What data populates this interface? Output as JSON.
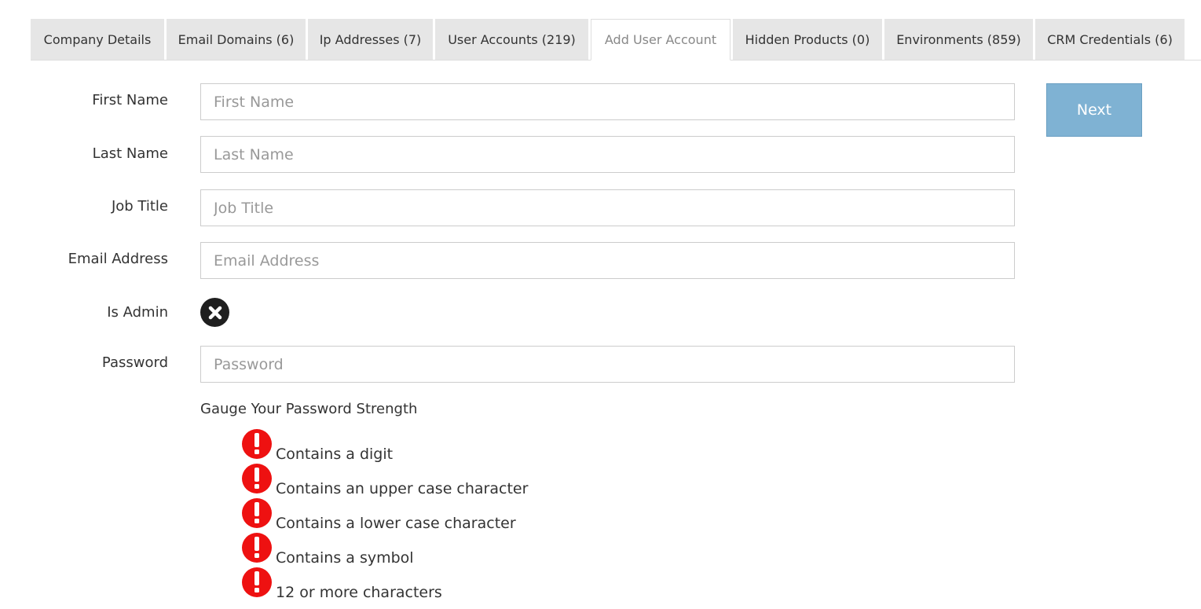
{
  "tabs": [
    {
      "label": "Company Details",
      "active": false
    },
    {
      "label": "Email Domains (6)",
      "active": false
    },
    {
      "label": "Ip Addresses (7)",
      "active": false
    },
    {
      "label": "User Accounts (219)",
      "active": false
    },
    {
      "label": "Add User Account",
      "active": true
    },
    {
      "label": "Hidden Products (0)",
      "active": false
    },
    {
      "label": "Environments (859)",
      "active": false
    },
    {
      "label": "CRM Credentials (6)",
      "active": false
    }
  ],
  "form": {
    "first_name": {
      "label": "First Name",
      "placeholder": "First Name",
      "value": ""
    },
    "last_name": {
      "label": "Last Name",
      "placeholder": "Last Name",
      "value": ""
    },
    "job_title": {
      "label": "Job Title",
      "placeholder": "Job Title",
      "value": ""
    },
    "email": {
      "label": "Email Address",
      "placeholder": "Email Address",
      "value": ""
    },
    "is_admin": {
      "label": "Is Admin",
      "checked": false,
      "icon": "x-circle-icon"
    },
    "password": {
      "label": "Password",
      "placeholder": "Password",
      "value": ""
    }
  },
  "next_button": {
    "label": "Next"
  },
  "password_strength": {
    "title": "Gauge Your Password Strength",
    "rules": [
      {
        "text": "Contains a digit",
        "met": false,
        "icon": "exclamation-icon"
      },
      {
        "text": "Contains an upper case character",
        "met": false,
        "icon": "exclamation-icon"
      },
      {
        "text": "Contains a lower case character",
        "met": false,
        "icon": "exclamation-icon"
      },
      {
        "text": "Contains a symbol",
        "met": false,
        "icon": "exclamation-icon"
      },
      {
        "text": "12 or more characters",
        "met": false,
        "icon": "exclamation-icon"
      }
    ]
  },
  "colors": {
    "tab_background": "#e6e6e6",
    "next_button": "#7fb2d3",
    "warning": "#ee1111",
    "toggle_off": "#1f1f1f"
  }
}
